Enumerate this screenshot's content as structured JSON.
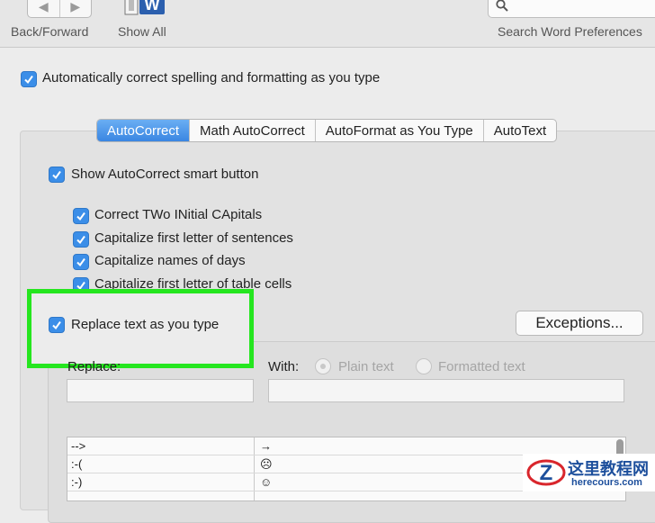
{
  "toolbar": {
    "back_forward_label": "Back/Forward",
    "show_all_label": "Show All",
    "search_label": "Search Word Preferences",
    "back_glyph": "◀",
    "forward_glyph": "▶"
  },
  "main": {
    "auto_correct_label": "Automatically correct spelling and formatting as you type",
    "tabs": [
      {
        "label": "AutoCorrect",
        "active": true
      },
      {
        "label": "Math AutoCorrect",
        "active": false
      },
      {
        "label": "AutoFormat as You Type",
        "active": false
      },
      {
        "label": "AutoText",
        "active": false
      }
    ],
    "show_smart_button_label": "Show AutoCorrect smart button",
    "options": [
      "Correct TWo INitial CApitals",
      "Capitalize first letter of sentences",
      "Capitalize names of days",
      "Capitalize first letter of table cells"
    ],
    "replace_text_label": "Replace text as you type",
    "exceptions_label": "Exceptions...",
    "replace_label": "Replace:",
    "with_label": "With:",
    "plain_text_label": "Plain text",
    "formatted_text_label": "Formatted text",
    "table_rows": [
      {
        "replace": "-->",
        "with": "→"
      },
      {
        "replace": ":-(",
        "with": "☹"
      },
      {
        "replace": ":-)",
        "with": "☺"
      }
    ]
  },
  "watermark": {
    "cn": "这里教程网",
    "url": "herecours.com"
  },
  "colors": {
    "accent": "#3b8ee8",
    "highlight": "#25e61f"
  }
}
